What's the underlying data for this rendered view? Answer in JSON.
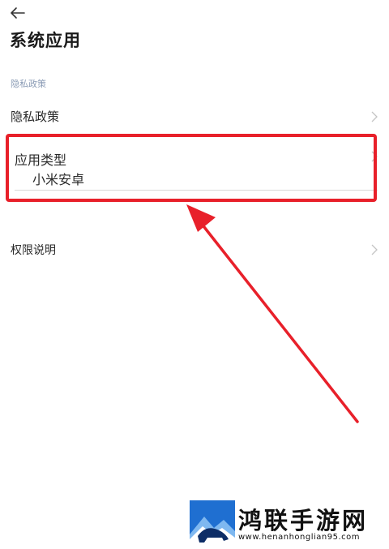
{
  "header": {
    "back_icon": "arrow-left-icon",
    "title": "系统应用"
  },
  "section": {
    "header": "隐私政策"
  },
  "rows": [
    {
      "label": "隐私政策",
      "icon": "chevron-right-icon"
    },
    {
      "label": "应用类型",
      "value": "小米安卓",
      "icon": "chevron-right-icon"
    },
    {
      "label": "权限说明",
      "icon": "chevron-right-icon"
    }
  ],
  "annotation": {
    "color": "#e8202a"
  },
  "watermark": {
    "title": "鸿联手游网",
    "url": "www.henanhonglian95.com",
    "logo_icon": "bison-logo-icon"
  }
}
